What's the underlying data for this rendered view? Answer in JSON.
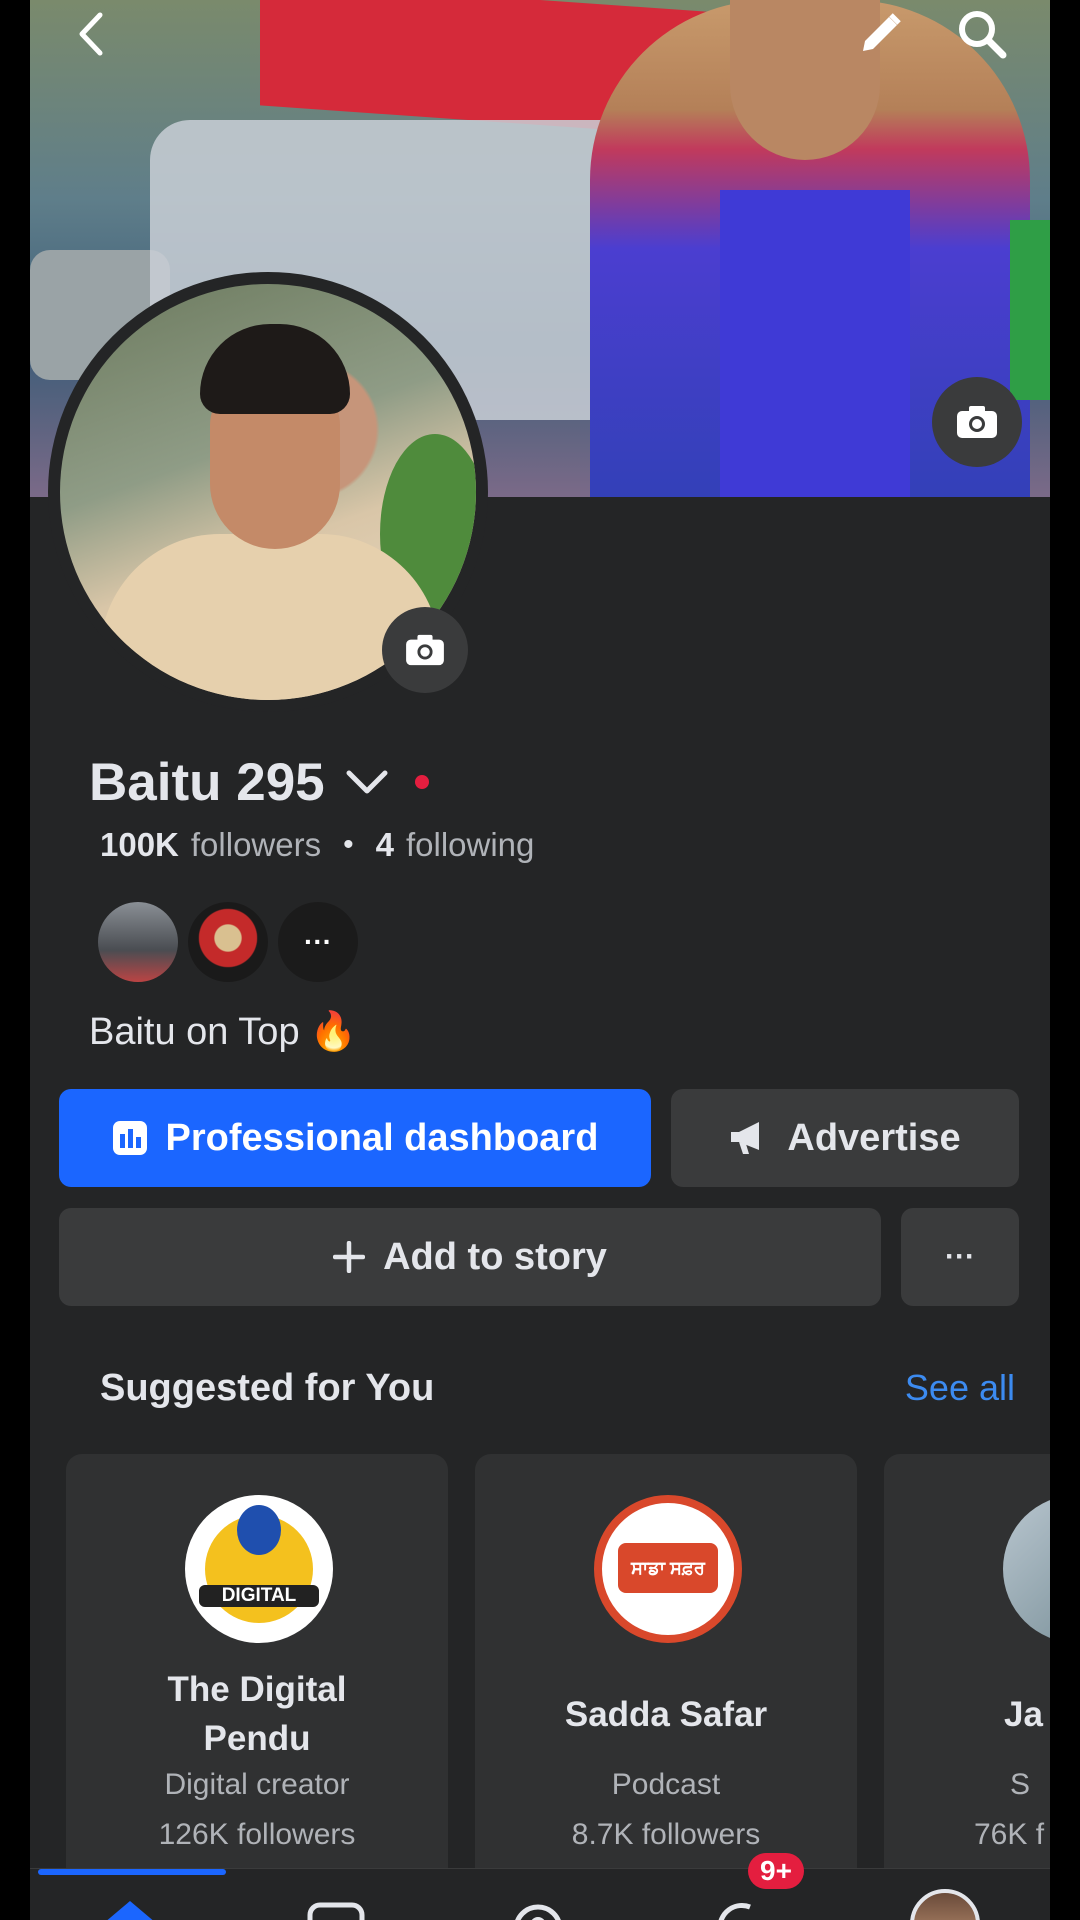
{
  "profile": {
    "name": "Baitu 295",
    "followers_count": "100K",
    "followers_label": "followers",
    "following_count": "4",
    "following_label": "following",
    "bio": "Baitu on Top",
    "bio_emoji": "🔥",
    "mini_more": "···"
  },
  "actions": {
    "dashboard": "Professional dashboard",
    "advertise": "Advertise",
    "add_story": "Add to story",
    "more": "···"
  },
  "suggested": {
    "title": "Suggested for You",
    "see_all": "See all",
    "cards": [
      {
        "name_line1": "The Digital",
        "name_line2": "Pendu",
        "category": "Digital creator",
        "followers": "126K followers",
        "logo_text": "DIGITAL"
      },
      {
        "name": "Sadda Safar",
        "category": "Podcast",
        "followers": "8.7K followers",
        "logo_text": "ਸਾਡਾ ਸਫ਼ਰ"
      },
      {
        "name": "Ja",
        "category": "S",
        "followers": "76K f"
      }
    ]
  },
  "nav": {
    "notifications_badge": "9+"
  },
  "colors": {
    "accent": "#1b66ff",
    "background": "#242526",
    "surface": "#3a3b3c",
    "link": "#3c8bf0",
    "badge": "#e41e3f",
    "online_dot": "#e41e3f"
  }
}
